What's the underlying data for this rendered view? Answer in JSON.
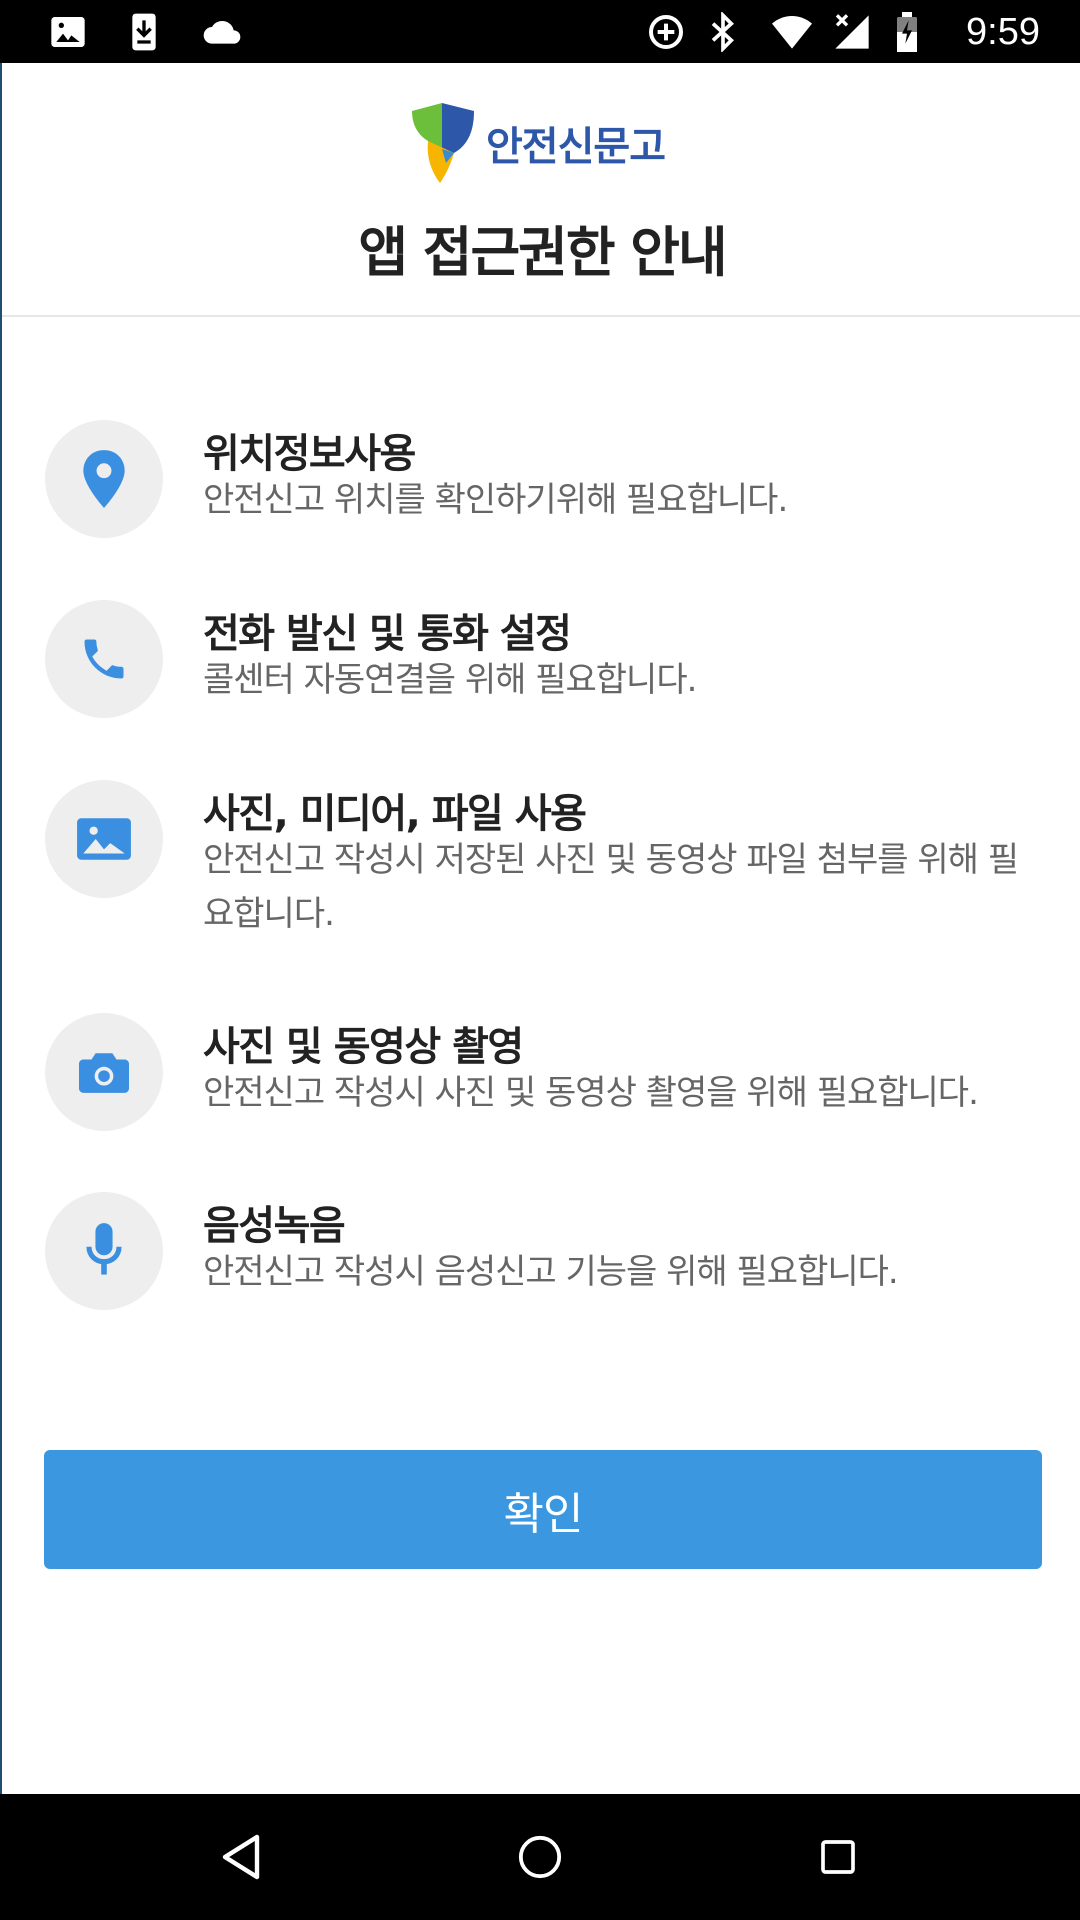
{
  "status_bar": {
    "time": "9:59",
    "left_icons": [
      "image-icon",
      "download-icon",
      "cloud-icon"
    ],
    "right_icons": [
      "data-saver-icon",
      "bluetooth-icon",
      "wifi-icon",
      "no-signal-icon",
      "battery-icon"
    ]
  },
  "header": {
    "logo_text": "안전신문고",
    "title": "앱 접근권한 안내"
  },
  "permissions": [
    {
      "icon": "location-pin-icon",
      "title": "위치정보사용",
      "description": "안전신고 위치를 확인하기위해 필요합니다."
    },
    {
      "icon": "phone-icon",
      "title": "전화 발신 및 통화 설정",
      "description": "콜센터 자동연결을 위해 필요합니다."
    },
    {
      "icon": "image-icon",
      "title": "사진, 미디어, 파일 사용",
      "description": "안전신고 작성시 저장된 사진 및 동영상 파일 첨부를 위해 필요합니다."
    },
    {
      "icon": "camera-icon",
      "title": "사진 및 동영상 촬영",
      "description": "안전신고 작성시 사진 및 동영상 촬영을 위해 필요합니다."
    },
    {
      "icon": "microphone-icon",
      "title": "음성녹음",
      "description": "안전신고 작성시 음성신고 기능을 위해 필요합니다."
    }
  ],
  "confirm_button": {
    "label": "확인"
  },
  "colors": {
    "accent": "#3b98e0",
    "icon_blue": "#3b8fe0",
    "logo_blue": "#2d57a8",
    "logo_green": "#6cbf3a",
    "logo_yellow": "#f7b500"
  },
  "nav_bar": {
    "buttons": [
      "back-icon",
      "home-icon",
      "recents-icon"
    ]
  }
}
